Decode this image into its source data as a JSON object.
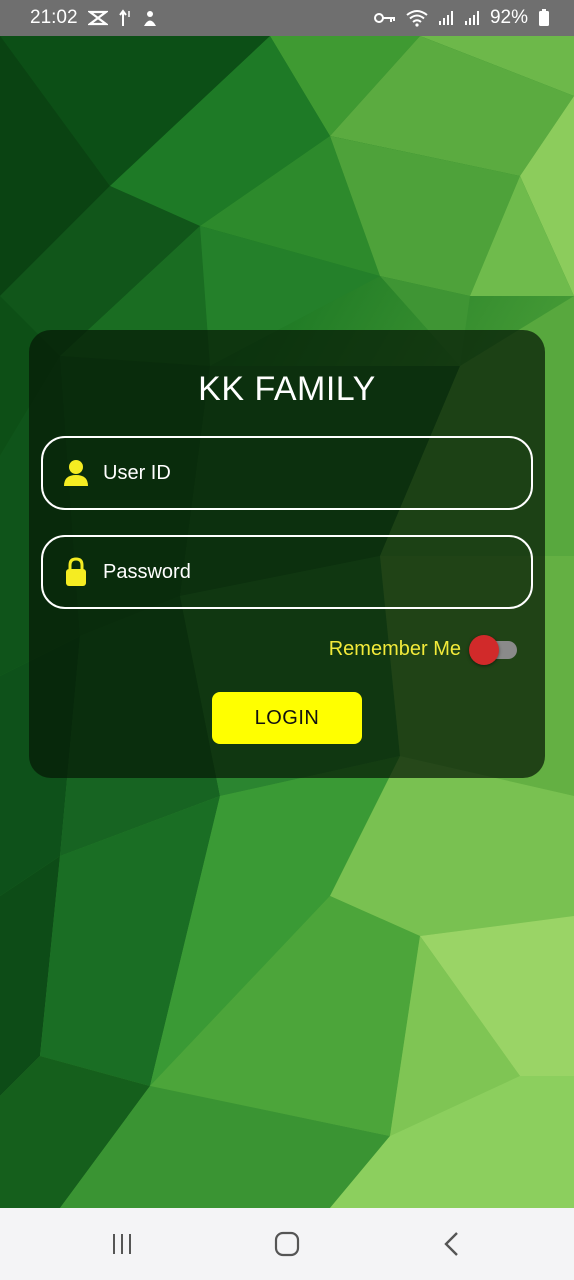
{
  "status_bar": {
    "time": "21:02",
    "battery_percent": "92%",
    "notification_icons": [
      "capcut-icon",
      "data-arrows-icon",
      "app-notification-icon"
    ],
    "system_icons": [
      "vpn-key-icon",
      "wifi-icon",
      "signal-icon",
      "signal-icon",
      "battery-icon"
    ]
  },
  "login": {
    "title": "KK FAMILY",
    "user_id_placeholder": "User ID",
    "password_placeholder": "Password",
    "remember_label": "Remember Me",
    "remember_enabled": false,
    "login_button_label": "LOGIN"
  },
  "colors": {
    "accent_yellow": "#ffff00",
    "remember_text": "#f2ea3a",
    "toggle_thumb": "#d12a2a",
    "card_bg": "rgba(5,25,5,0.72)"
  },
  "nav_bar": {
    "buttons": [
      "recents-icon",
      "home-icon",
      "back-icon"
    ]
  }
}
